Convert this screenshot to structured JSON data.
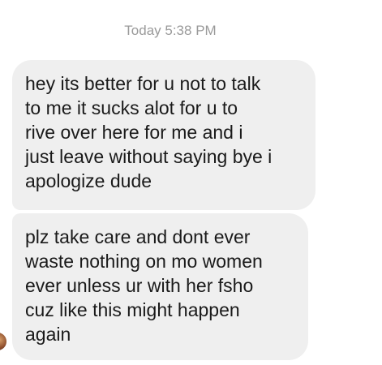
{
  "conversation": {
    "timestamp": "Today 5:38 PM",
    "messages": [
      {
        "text": "hey its better for u not to talk\nto me it sucks alot for u to\nrive over here for me and i\njust leave without saying bye i\napologize dude"
      },
      {
        "text": "plz take care and dont ever\nwaste nothing on mo women\never unless ur with her fsho\ncuz like this might happen\nagain"
      }
    ]
  }
}
